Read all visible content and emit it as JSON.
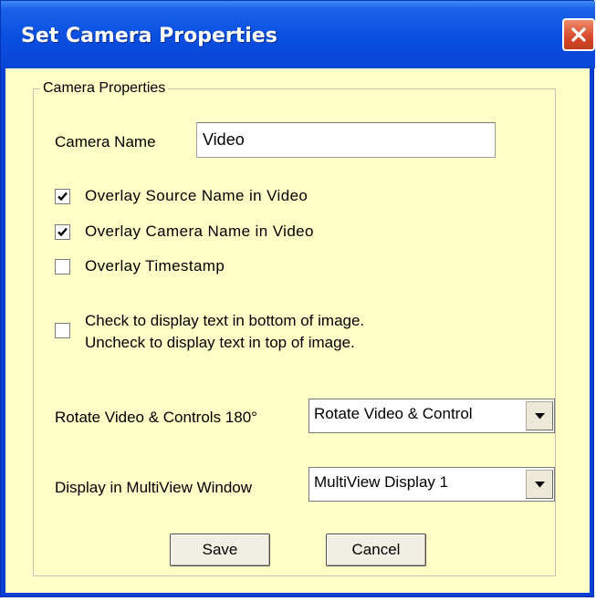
{
  "window": {
    "title": "Set Camera Properties"
  },
  "group": {
    "title": "Camera Properties"
  },
  "camera_name": {
    "label": "Camera Name",
    "value": "Video"
  },
  "checkboxes": [
    {
      "label": "Overlay Source Name in Video",
      "checked": true
    },
    {
      "label": "Overlay Camera Name in Video",
      "checked": true
    },
    {
      "label": "Overlay Timestamp",
      "checked": false
    }
  ],
  "text_position": {
    "line1": "Check to display text in bottom of image.",
    "line2": "Uncheck to display text in top of image.",
    "checked": false
  },
  "rotate": {
    "label": "Rotate Video & Controls 180°",
    "selected": "Rotate Video & Control"
  },
  "multiview": {
    "label": "Display in MultiView Window",
    "selected": "MultiView Display 1"
  },
  "buttons": {
    "save": "Save",
    "cancel": "Cancel"
  },
  "icons": {
    "close": "close-icon",
    "checkmark": "checkmark-icon",
    "dropdown": "chevron-down-icon"
  },
  "colors": {
    "titlebar": "#0a4fe0",
    "client_bg": "#ffffc8",
    "close_button": "#d6492a"
  }
}
